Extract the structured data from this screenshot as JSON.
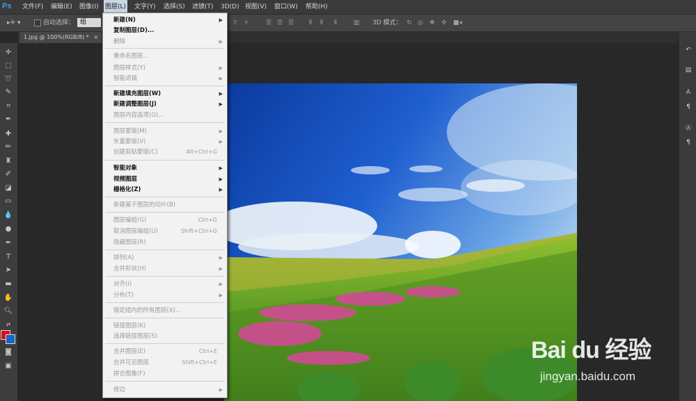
{
  "app": {
    "logo": "Ps"
  },
  "menubar": {
    "items": [
      {
        "label": "文件(F)"
      },
      {
        "label": "编辑(E)"
      },
      {
        "label": "图像(I)"
      },
      {
        "label": "图层(L)"
      },
      {
        "label": "文字(Y)"
      },
      {
        "label": "选择(S)"
      },
      {
        "label": "滤镜(T)"
      },
      {
        "label": "3D(D)"
      },
      {
        "label": "视图(V)"
      },
      {
        "label": "窗口(W)"
      },
      {
        "label": "帮助(H)"
      }
    ]
  },
  "options": {
    "auto_select_label": "自动选择：",
    "auto_select_value": "组",
    "mode_3d_label": "3D 模式："
  },
  "document": {
    "tab_title": "1.jpg @ 100%(RGB/8) *",
    "close": "×"
  },
  "layer_menu": {
    "items": [
      {
        "label": "新建(N)",
        "shortcut": "",
        "submenu": true,
        "enabled": true
      },
      {
        "label": "复制图层(D)...",
        "shortcut": "",
        "submenu": false,
        "enabled": true
      },
      {
        "label": "删除",
        "shortcut": "",
        "submenu": true,
        "enabled": false
      },
      {
        "label": "重命名图层...",
        "shortcut": "",
        "submenu": false,
        "enabled": false
      },
      {
        "label": "图层样式(Y)",
        "shortcut": "",
        "submenu": true,
        "enabled": false
      },
      {
        "label": "智能滤镜",
        "shortcut": "",
        "submenu": true,
        "enabled": false
      },
      {
        "label": "新建填充图层(W)",
        "shortcut": "",
        "submenu": true,
        "enabled": true
      },
      {
        "label": "新建调整图层(J)",
        "shortcut": "",
        "submenu": true,
        "enabled": true
      },
      {
        "label": "图层内容选项(O)...",
        "shortcut": "",
        "submenu": false,
        "enabled": false
      },
      {
        "label": "图层蒙版(M)",
        "shortcut": "",
        "submenu": true,
        "enabled": false
      },
      {
        "label": "矢量蒙版(V)",
        "shortcut": "",
        "submenu": true,
        "enabled": false
      },
      {
        "label": "创建剪贴蒙版(C)",
        "shortcut": "Alt+Ctrl+G",
        "submenu": false,
        "enabled": false
      },
      {
        "label": "智能对象",
        "shortcut": "",
        "submenu": true,
        "enabled": true
      },
      {
        "label": "视频图层",
        "shortcut": "",
        "submenu": true,
        "enabled": true
      },
      {
        "label": "栅格化(Z)",
        "shortcut": "",
        "submenu": true,
        "enabled": true
      },
      {
        "label": "新建基于图层的切片(B)",
        "shortcut": "",
        "submenu": false,
        "enabled": false
      },
      {
        "label": "图层编组(G)",
        "shortcut": "Ctrl+G",
        "submenu": false,
        "enabled": false
      },
      {
        "label": "取消图层编组(U)",
        "shortcut": "Shift+Ctrl+G",
        "submenu": false,
        "enabled": false
      },
      {
        "label": "隐藏图层(R)",
        "shortcut": "",
        "submenu": false,
        "enabled": false
      },
      {
        "label": "排列(A)",
        "shortcut": "",
        "submenu": true,
        "enabled": false
      },
      {
        "label": "合并形状(H)",
        "shortcut": "",
        "submenu": true,
        "enabled": false
      },
      {
        "label": "对齐(I)",
        "shortcut": "",
        "submenu": true,
        "enabled": false
      },
      {
        "label": "分布(T)",
        "shortcut": "",
        "submenu": true,
        "enabled": false
      },
      {
        "label": "锁定组内的所有图层(X)...",
        "shortcut": "",
        "submenu": false,
        "enabled": false
      },
      {
        "label": "链接图层(K)",
        "shortcut": "",
        "submenu": false,
        "enabled": false
      },
      {
        "label": "选择链接图层(S)",
        "shortcut": "",
        "submenu": false,
        "enabled": false
      },
      {
        "label": "合并图层(E)",
        "shortcut": "Ctrl+E",
        "submenu": false,
        "enabled": false
      },
      {
        "label": "合并可见图层",
        "shortcut": "Shift+Ctrl+E",
        "submenu": false,
        "enabled": false
      },
      {
        "label": "拼合图像(F)",
        "shortcut": "",
        "submenu": false,
        "enabled": false
      },
      {
        "label": "修边",
        "shortcut": "",
        "submenu": true,
        "enabled": false
      }
    ]
  },
  "colors": {
    "foreground": "#e00f0f",
    "background": "#1566c6",
    "menu_highlight": "#c9d6e6"
  },
  "watermark": {
    "logo": "Bai du 经验",
    "url": "jingyan.baidu.com"
  }
}
